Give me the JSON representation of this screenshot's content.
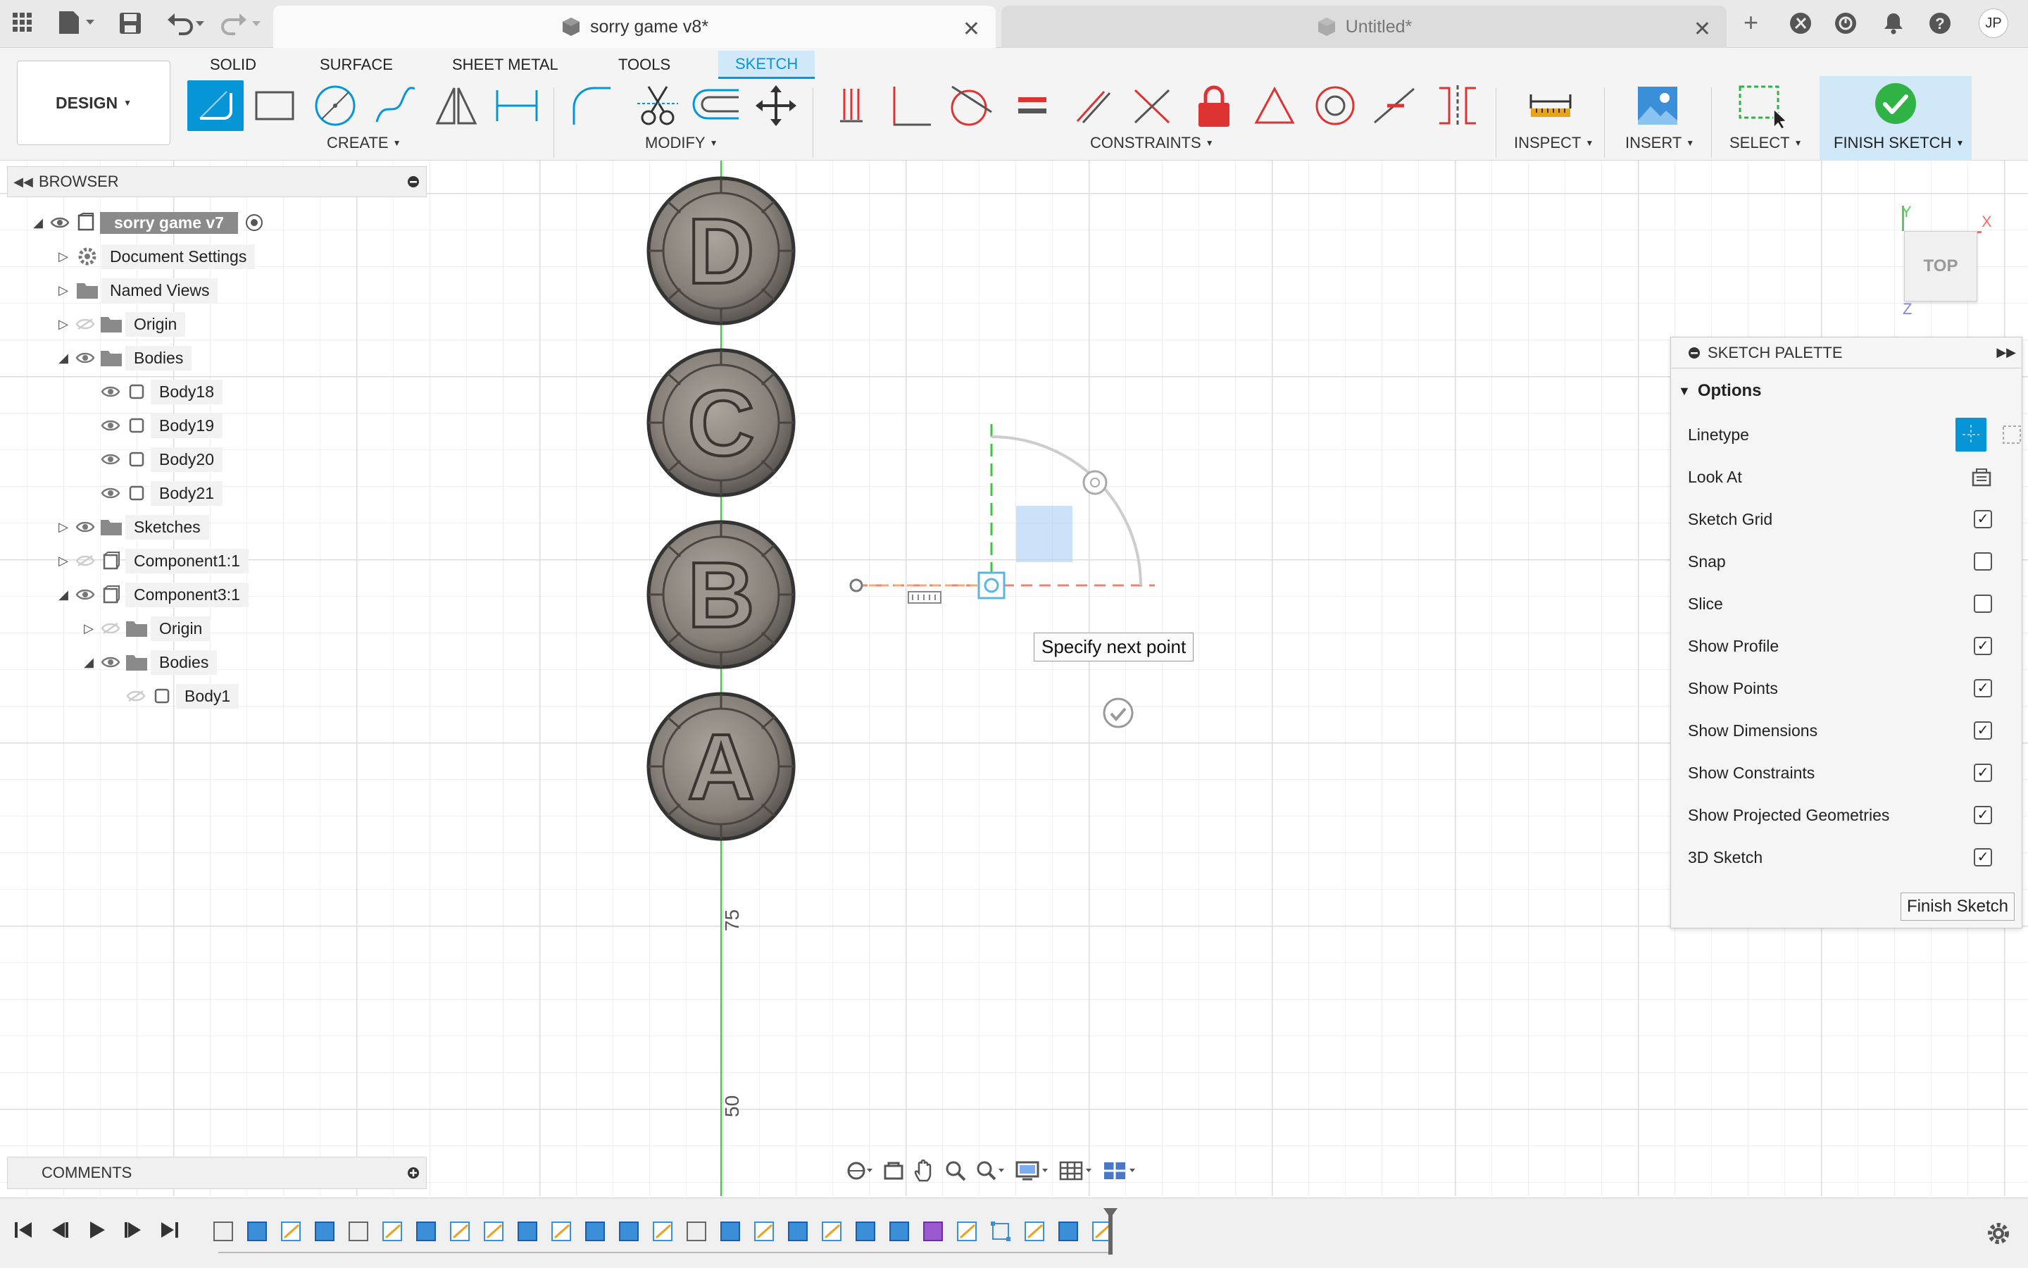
{
  "titlebar": {
    "tabs": [
      {
        "title": "sorry game v8*",
        "active": true
      },
      {
        "title": "Untitled*",
        "active": false
      }
    ],
    "user_initials": "JP"
  },
  "toolbar": {
    "workspace_tabs": [
      "SOLID",
      "SURFACE",
      "SHEET METAL",
      "TOOLS",
      "SKETCH"
    ],
    "active_tab": "SKETCH",
    "design_label": "DESIGN",
    "groups": {
      "create": "CREATE",
      "modify": "MODIFY",
      "constraints": "CONSTRAINTS",
      "inspect": "INSPECT",
      "insert": "INSERT",
      "select": "SELECT",
      "finish": "FINISH SKETCH"
    },
    "accent": "#0696d7",
    "finish_color": "#2fb344"
  },
  "browser": {
    "title": "BROWSER",
    "root": "sorry game v7",
    "items": [
      {
        "label": "Document Settings",
        "icon": "gear-icon",
        "level": 1,
        "expand": "collapsed",
        "eye": "none"
      },
      {
        "label": "Named Views",
        "icon": "folder-icon",
        "level": 1,
        "expand": "collapsed",
        "eye": "none"
      },
      {
        "label": "Origin",
        "icon": "folder-icon",
        "level": 1,
        "expand": "collapsed",
        "eye": "hidden"
      },
      {
        "label": "Bodies",
        "icon": "folder-icon",
        "level": 1,
        "expand": "expanded",
        "eye": "visible"
      },
      {
        "label": "Body18",
        "icon": "body-icon",
        "level": 2,
        "expand": "none",
        "eye": "visible"
      },
      {
        "label": "Body19",
        "icon": "body-icon",
        "level": 2,
        "expand": "none",
        "eye": "visible"
      },
      {
        "label": "Body20",
        "icon": "body-icon",
        "level": 2,
        "expand": "none",
        "eye": "visible"
      },
      {
        "label": "Body21",
        "icon": "body-icon",
        "level": 2,
        "expand": "none",
        "eye": "visible"
      },
      {
        "label": "Sketches",
        "icon": "folder-icon",
        "level": 1,
        "expand": "collapsed",
        "eye": "visible"
      },
      {
        "label": "Component1:1",
        "icon": "component-icon",
        "level": 1,
        "expand": "collapsed",
        "eye": "hidden"
      },
      {
        "label": "Component3:1",
        "icon": "component-icon",
        "level": 1,
        "expand": "expanded",
        "eye": "visible"
      },
      {
        "label": "Origin",
        "icon": "folder-icon",
        "level": 2,
        "expand": "collapsed",
        "eye": "hidden"
      },
      {
        "label": "Bodies",
        "icon": "folder-icon",
        "level": 2,
        "expand": "expanded",
        "eye": "visible"
      },
      {
        "label": "Body1",
        "icon": "body-icon",
        "level": 3,
        "expand": "none",
        "eye": "hidden"
      }
    ]
  },
  "canvas": {
    "tokens": [
      "D",
      "C",
      "B",
      "A"
    ],
    "tooltip": "Specify next point",
    "ruler_labels": [
      "75",
      "50"
    ],
    "viewcube_label": "TOP",
    "axes": {
      "x": "X",
      "y": "Y",
      "z": "Z"
    }
  },
  "palette": {
    "title": "SKETCH PALETTE",
    "section": "Options",
    "linetype_label": "Linetype",
    "look_at_label": "Look At",
    "options": [
      {
        "label": "Sketch Grid",
        "checked": true
      },
      {
        "label": "Snap",
        "checked": false
      },
      {
        "label": "Slice",
        "checked": false
      },
      {
        "label": "Show Profile",
        "checked": true
      },
      {
        "label": "Show Points",
        "checked": true
      },
      {
        "label": "Show Dimensions",
        "checked": true
      },
      {
        "label": "Show Constraints",
        "checked": true
      },
      {
        "label": "Show Projected Geometries",
        "checked": true
      },
      {
        "label": "3D Sketch",
        "checked": true
      }
    ],
    "finish_button": "Finish Sketch"
  },
  "comments": {
    "title": "COMMENTS"
  }
}
